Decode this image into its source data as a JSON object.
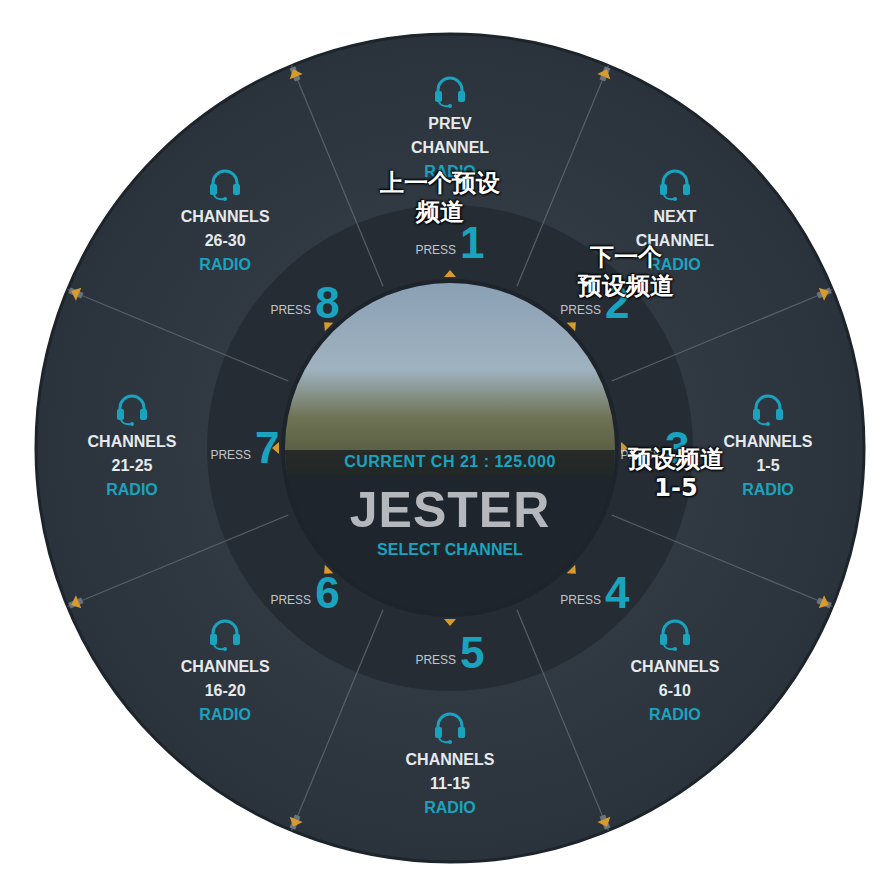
{
  "menu": {
    "title": "JESTER",
    "subtitle": "SELECT CHANNEL",
    "current": "CURRENT CH 21 : 125.000"
  },
  "items": [
    {
      "number": "1",
      "press": "PRESS",
      "lines": [
        "PREV",
        "CHANNEL"
      ],
      "category": "RADIO"
    },
    {
      "number": "2",
      "press": "PRESS",
      "lines": [
        "NEXT",
        "CHANNEL"
      ],
      "category": "RADIO"
    },
    {
      "number": "3",
      "press": "PRESS",
      "lines": [
        "CHANNELS",
        "1-5"
      ],
      "category": "RADIO"
    },
    {
      "number": "4",
      "press": "PRESS",
      "lines": [
        "CHANNELS",
        "6-10"
      ],
      "category": "RADIO"
    },
    {
      "number": "5",
      "press": "PRESS",
      "lines": [
        "CHANNELS",
        "11-15"
      ],
      "category": "RADIO"
    },
    {
      "number": "6",
      "press": "PRESS",
      "lines": [
        "CHANNELS",
        "16-20"
      ],
      "category": "RADIO"
    },
    {
      "number": "7",
      "press": "PRESS",
      "lines": [
        "CHANNELS",
        "21-25"
      ],
      "category": "RADIO"
    },
    {
      "number": "8",
      "press": "PRESS",
      "lines": [
        "CHANNELS",
        "26-30"
      ],
      "category": "RADIO"
    }
  ],
  "annotations": [
    {
      "lines": [
        "上一个预设",
        "频道"
      ]
    },
    {
      "lines": [
        "下一个",
        "预设频道"
      ]
    },
    {
      "lines": [
        "预设频道",
        "1-5"
      ]
    }
  ]
}
